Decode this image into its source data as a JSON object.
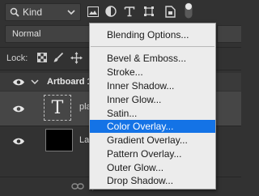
{
  "filter": {
    "kind_label": "Kind",
    "icons": [
      "search-icon",
      "chevron-down-icon",
      "image-filter-icon",
      "adjustment-filter-icon",
      "type-filter-icon",
      "shape-filter-icon",
      "smart-object-filter-icon",
      "filter-toggle-icon"
    ]
  },
  "blend": {
    "mode": "Normal"
  },
  "lock": {
    "label": "Lock:",
    "icons": [
      "lock-transparent-pixels-icon",
      "lock-image-pixels-icon",
      "lock-position-icon"
    ]
  },
  "layers": [
    {
      "name": "Artboard 1",
      "type": "artboard",
      "expanded": true
    },
    {
      "name": "pla",
      "type": "text",
      "selected": true
    },
    {
      "name": "La",
      "type": "shape"
    }
  ],
  "bottom_bar": {
    "icons": [
      "link-layers-icon",
      "add-style-icon"
    ]
  },
  "menu": {
    "items": [
      {
        "label": "Blending Options...",
        "highlighted": false
      },
      {
        "label": "Bevel & Emboss...",
        "highlighted": false
      },
      {
        "label": "Stroke...",
        "highlighted": false
      },
      {
        "label": "Inner Shadow...",
        "highlighted": false
      },
      {
        "label": "Inner Glow...",
        "highlighted": false
      },
      {
        "label": "Satin...",
        "highlighted": false
      },
      {
        "label": "Color Overlay...",
        "highlighted": true
      },
      {
        "label": "Gradient Overlay...",
        "highlighted": false
      },
      {
        "label": "Pattern Overlay...",
        "highlighted": false
      },
      {
        "label": "Outer Glow...",
        "highlighted": false
      },
      {
        "label": "Drop Shadow...",
        "highlighted": false
      }
    ]
  },
  "colors": {
    "panel_bg": "#323232",
    "selected_row": "#464646",
    "menu_bg": "#ececec",
    "menu_highlight": "#1473e6"
  }
}
